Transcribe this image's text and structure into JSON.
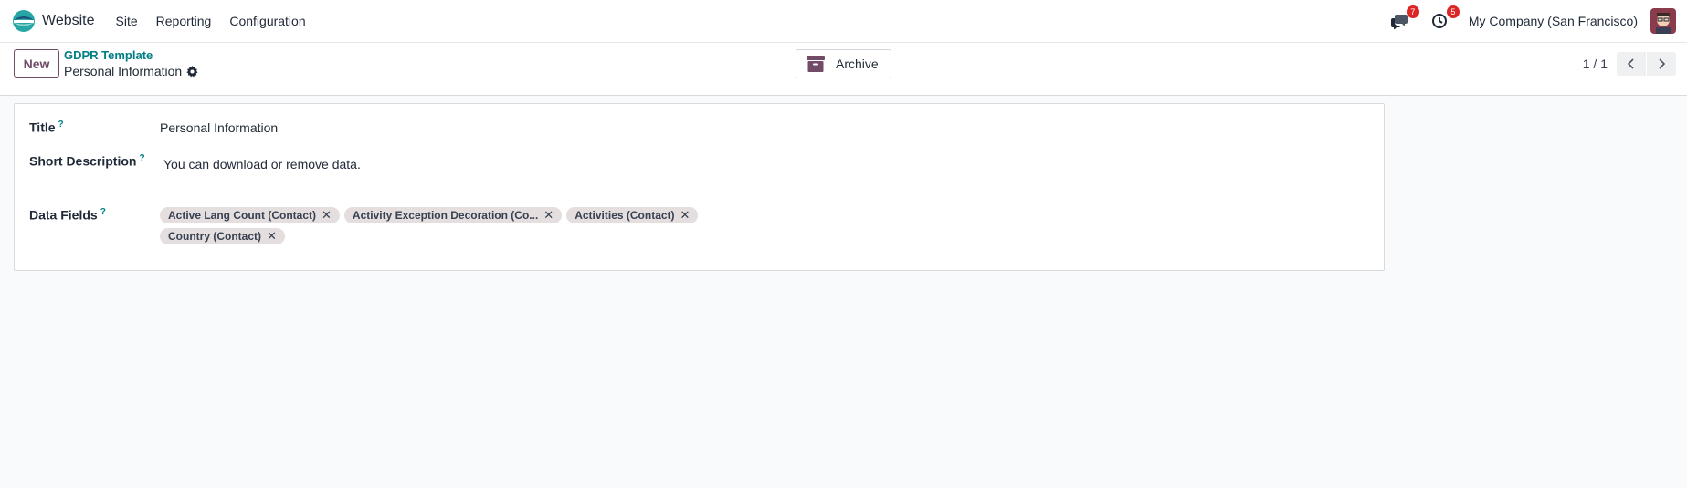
{
  "navbar": {
    "app_name": "Website",
    "menu": [
      "Site",
      "Reporting",
      "Configuration"
    ],
    "messages_badge": "7",
    "activities_badge": "5",
    "company": "My Company (San Francisco)"
  },
  "control_panel": {
    "new_label": "New",
    "breadcrumb_parent": "GDPR Template",
    "breadcrumb_current": "Personal Information",
    "archive_label": "Archive",
    "pager_value": "1 / 1"
  },
  "form": {
    "title_label": "Title",
    "title_value": "Personal Information",
    "short_description_label": "Short Description",
    "short_description_value": "You can download or remove data.",
    "data_fields_label": "Data Fields",
    "help_mark": "?",
    "data_fields": [
      "Active Lang Count (Contact)",
      "Activity Exception Decoration (Co...",
      "Activities (Contact)",
      "Country (Contact)"
    ]
  },
  "colors": {
    "brand": "#714b67",
    "link": "#017e84",
    "badge": "#dc2626",
    "tag_bg": "#e5dede"
  },
  "icons": [
    "odoo-website-logo",
    "chat-icon",
    "clock-icon",
    "gear-icon",
    "archive-box-icon",
    "chevron-left-icon",
    "chevron-right-icon",
    "remove-tag-icon"
  ]
}
